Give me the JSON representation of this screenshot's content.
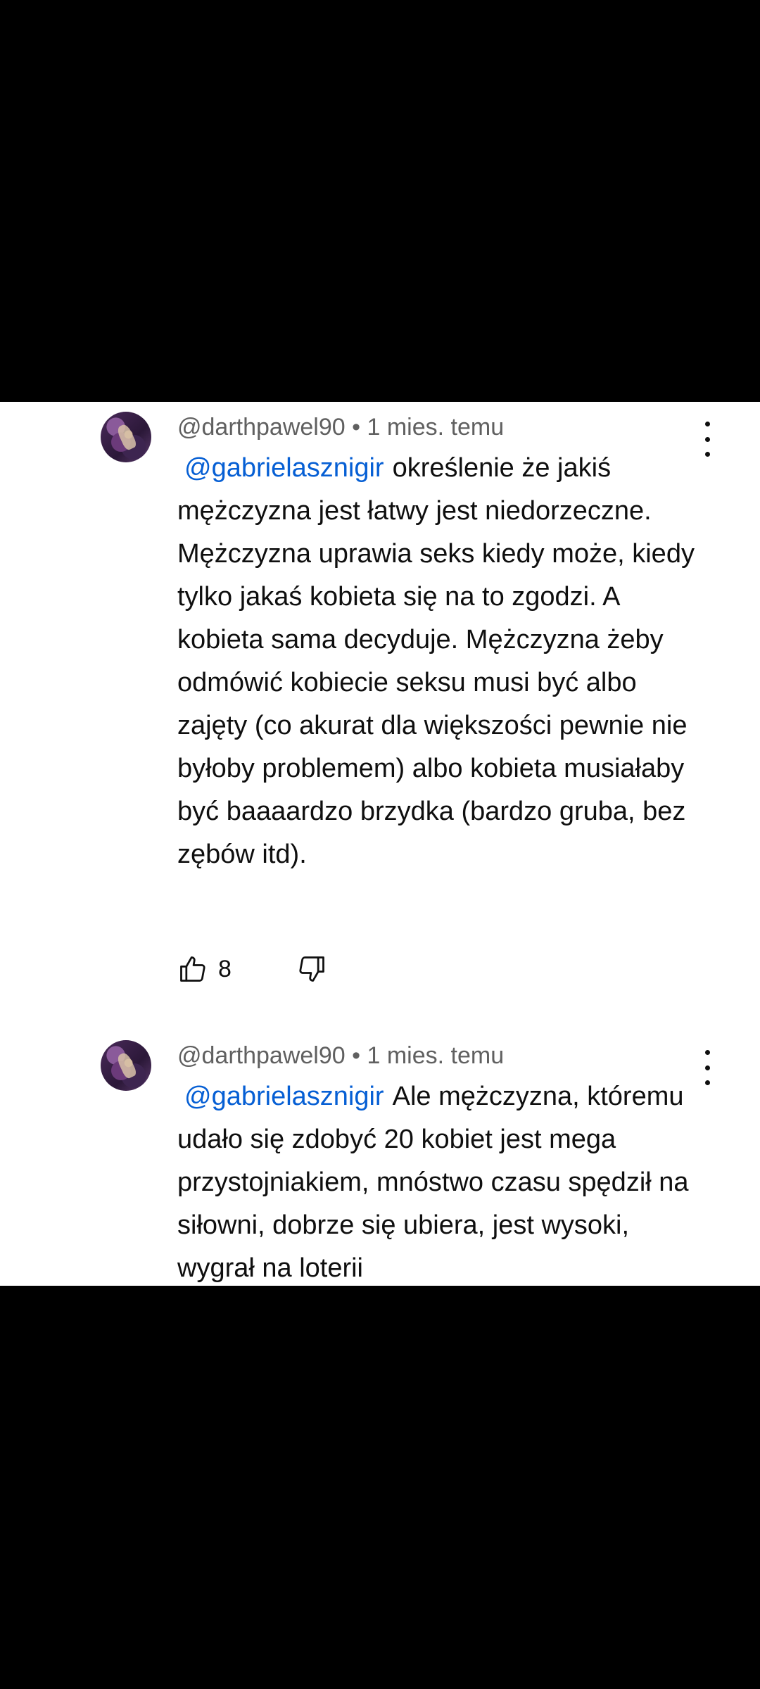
{
  "comments": [
    {
      "author": "@darthpawel90",
      "separator": "•",
      "time": "1 mies. temu",
      "mention": "@gabrielasznigir",
      "text": "określenie że jakiś mężczyzna jest łatwy jest niedorzeczne. Mężczyzna uprawia seks kiedy może, kiedy tylko jakaś kobieta się na to zgodzi. A kobieta sama decyduje. Mężczyzna żeby odmówić kobiecie seksu musi być albo zajęty (co akurat dla większości pewnie nie byłoby problemem) albo kobieta musiałaby być baaaardzo brzydka (bardzo gruba, bez zębów itd).",
      "likes": "8"
    },
    {
      "author": "@darthpawel90",
      "separator": "•",
      "time": "1 mies. temu",
      "mention": "@gabrielasznigir",
      "text": "Ale mężczyzna, któremu udało się zdobyć 20 kobiet jest mega przystojniakiem, mnóstwo czasu spędził na siłowni, dobrze się ubiera, jest wysoki, wygrał na loterii"
    }
  ]
}
